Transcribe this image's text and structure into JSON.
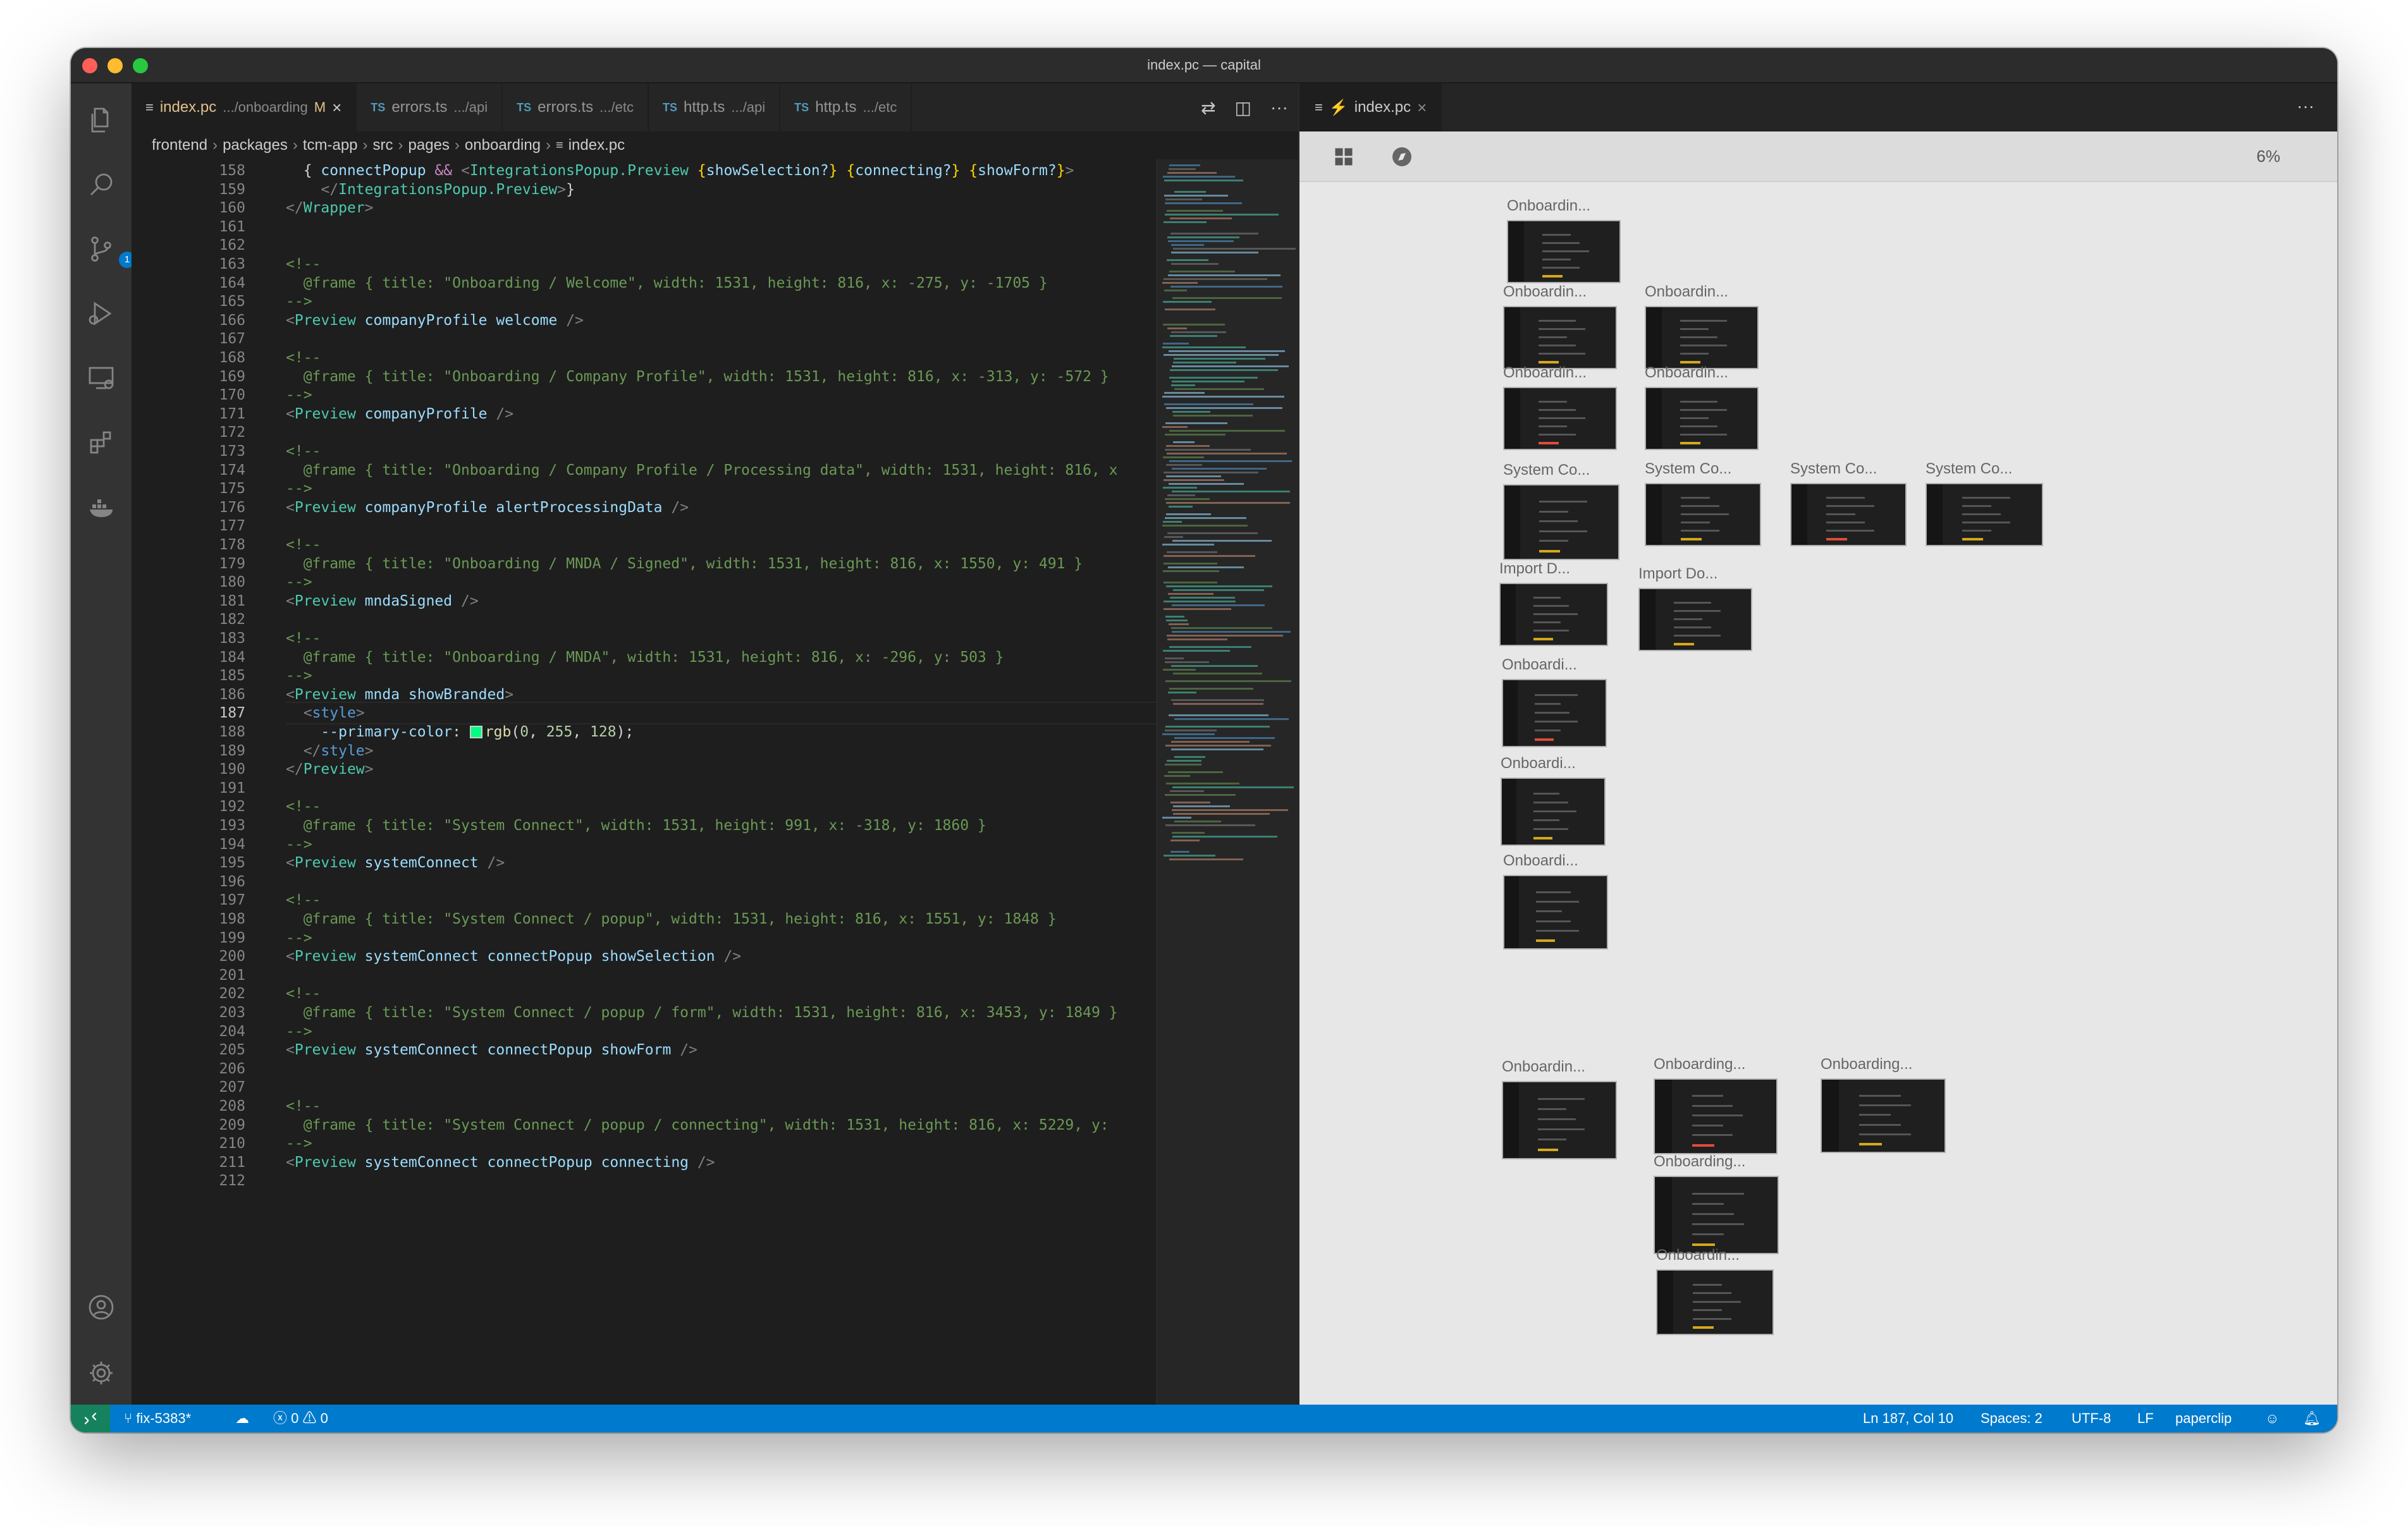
{
  "window": {
    "title": "index.pc — capital"
  },
  "colors": {
    "accent": "#007acc",
    "remote": "#16825d",
    "editor_bg": "#1e1e1e",
    "preview_bg": "#e7e7e7"
  },
  "activity_icons": [
    "files-icon",
    "search-icon",
    "source-control-icon",
    "run-debug-icon",
    "remote-explorer-icon",
    "extensions-icon",
    "docker-icon",
    "account-icon",
    "settings-gear-icon"
  ],
  "source_control_badge": "1",
  "tabs": [
    {
      "label": "index.pc",
      "dim": ".../onboarding",
      "status": "M",
      "type": "pc"
    },
    {
      "label": "errors.ts",
      "dim": ".../api",
      "type": "ts"
    },
    {
      "label": "errors.ts",
      "dim": ".../etc",
      "type": "ts"
    },
    {
      "label": "http.ts",
      "dim": ".../api",
      "type": "ts"
    },
    {
      "label": "http.ts",
      "dim": ".../etc",
      "type": "ts"
    }
  ],
  "tab_prefix": "TS",
  "tab_actions": {
    "more": "···"
  },
  "breadcrumb": [
    "frontend",
    "packages",
    "tcm-app",
    "src",
    "pages",
    "onboarding",
    "index.pc"
  ],
  "current_line": 187,
  "code_lines": [
    {
      "n": 158,
      "t": "  { connectPopup && <IntegrationsPopup.Preview {showSelection?} {connecting?} {showForm?}>"
    },
    {
      "n": 159,
      "t": "    </IntegrationsPopup.Preview>}"
    },
    {
      "n": 160,
      "t": "</Wrapper>"
    },
    {
      "n": 161,
      "t": ""
    },
    {
      "n": 162,
      "t": ""
    },
    {
      "n": 163,
      "t": "<!--"
    },
    {
      "n": 164,
      "t": "  @frame { title: \"Onboarding / Welcome\", width: 1531, height: 816, x: -275, y: -1705 }"
    },
    {
      "n": 165,
      "t": "-->"
    },
    {
      "n": 166,
      "t": "<Preview companyProfile welcome />"
    },
    {
      "n": 167,
      "t": ""
    },
    {
      "n": 168,
      "t": "<!--"
    },
    {
      "n": 169,
      "t": "  @frame { title: \"Onboarding / Company Profile\", width: 1531, height: 816, x: -313, y: -572 }"
    },
    {
      "n": 170,
      "t": "-->"
    },
    {
      "n": 171,
      "t": "<Preview companyProfile />"
    },
    {
      "n": 172,
      "t": ""
    },
    {
      "n": 173,
      "t": "<!--"
    },
    {
      "n": 174,
      "t": "  @frame { title: \"Onboarding / Company Profile / Processing data\", width: 1531, height: 816, x"
    },
    {
      "n": 175,
      "t": "-->"
    },
    {
      "n": 176,
      "t": "<Preview companyProfile alertProcessingData />"
    },
    {
      "n": 177,
      "t": ""
    },
    {
      "n": 178,
      "t": "<!--"
    },
    {
      "n": 179,
      "t": "  @frame { title: \"Onboarding / MNDA / Signed\", width: 1531, height: 816, x: 1550, y: 491 }"
    },
    {
      "n": 180,
      "t": "-->"
    },
    {
      "n": 181,
      "t": "<Preview mndaSigned />"
    },
    {
      "n": 182,
      "t": ""
    },
    {
      "n": 183,
      "t": "<!--"
    },
    {
      "n": 184,
      "t": "  @frame { title: \"Onboarding / MNDA\", width: 1531, height: 816, x: -296, y: 503 }"
    },
    {
      "n": 185,
      "t": "-->"
    },
    {
      "n": 186,
      "t": "<Preview mnda showBranded>"
    },
    {
      "n": 187,
      "t": "  <style>"
    },
    {
      "n": 188,
      "t": "    --primary-color: rgb(0, 255, 128);"
    },
    {
      "n": 189,
      "t": "  </style>"
    },
    {
      "n": 190,
      "t": "</Preview>"
    },
    {
      "n": 191,
      "t": ""
    },
    {
      "n": 192,
      "t": "<!--"
    },
    {
      "n": 193,
      "t": "  @frame { title: \"System Connect\", width: 1531, height: 991, x: -318, y: 1860 }"
    },
    {
      "n": 194,
      "t": "-->"
    },
    {
      "n": 195,
      "t": "<Preview systemConnect />"
    },
    {
      "n": 196,
      "t": ""
    },
    {
      "n": 197,
      "t": "<!--"
    },
    {
      "n": 198,
      "t": "  @frame { title: \"System Connect / popup\", width: 1531, height: 816, x: 1551, y: 1848 }"
    },
    {
      "n": 199,
      "t": "-->"
    },
    {
      "n": 200,
      "t": "<Preview systemConnect connectPopup showSelection />"
    },
    {
      "n": 201,
      "t": ""
    },
    {
      "n": 202,
      "t": "<!--"
    },
    {
      "n": 203,
      "t": "  @frame { title: \"System Connect / popup / form\", width: 1531, height: 816, x: 3453, y: 1849 }"
    },
    {
      "n": 204,
      "t": "-->"
    },
    {
      "n": 205,
      "t": "<Preview systemConnect connectPopup showForm />"
    },
    {
      "n": 206,
      "t": ""
    },
    {
      "n": 207,
      "t": ""
    },
    {
      "n": 208,
      "t": "<!--"
    },
    {
      "n": 209,
      "t": "  @frame { title: \"System Connect / popup / connecting\", width: 1531, height: 816, x: 5229, y:"
    },
    {
      "n": 210,
      "t": "-->"
    },
    {
      "n": 211,
      "t": "<Preview systemConnect connectPopup connecting />"
    },
    {
      "n": 212,
      "t": ""
    }
  ],
  "preview": {
    "tab_label": "index.pc",
    "zoom": "6%",
    "more": "···",
    "frames": [
      {
        "label": "Onboardin..."
      },
      {
        "label": "Onboardin..."
      },
      {
        "label": "Onboardin..."
      },
      {
        "label": "Onboardin..."
      },
      {
        "label": "Onboardin..."
      },
      {
        "label": "System Co..."
      },
      {
        "label": "System Co..."
      },
      {
        "label": "System Co..."
      },
      {
        "label": "System Co..."
      },
      {
        "label": "Import D..."
      },
      {
        "label": "Import Do..."
      },
      {
        "label": "Onboardi..."
      },
      {
        "label": "Onboardi..."
      },
      {
        "label": "Onboardi..."
      },
      {
        "label": "Onboardin..."
      },
      {
        "label": "Onboarding..."
      },
      {
        "label": "Onboarding..."
      },
      {
        "label": "Onboarding..."
      },
      {
        "label": "Onboardin..."
      }
    ]
  },
  "statusbar": {
    "branch": "fix-5383*",
    "errors": "0",
    "warnings": "0",
    "position": "Ln 187, Col 10",
    "spaces": "Spaces: 2",
    "encoding": "UTF-8",
    "eol": "LF",
    "extension": "paperclip"
  }
}
